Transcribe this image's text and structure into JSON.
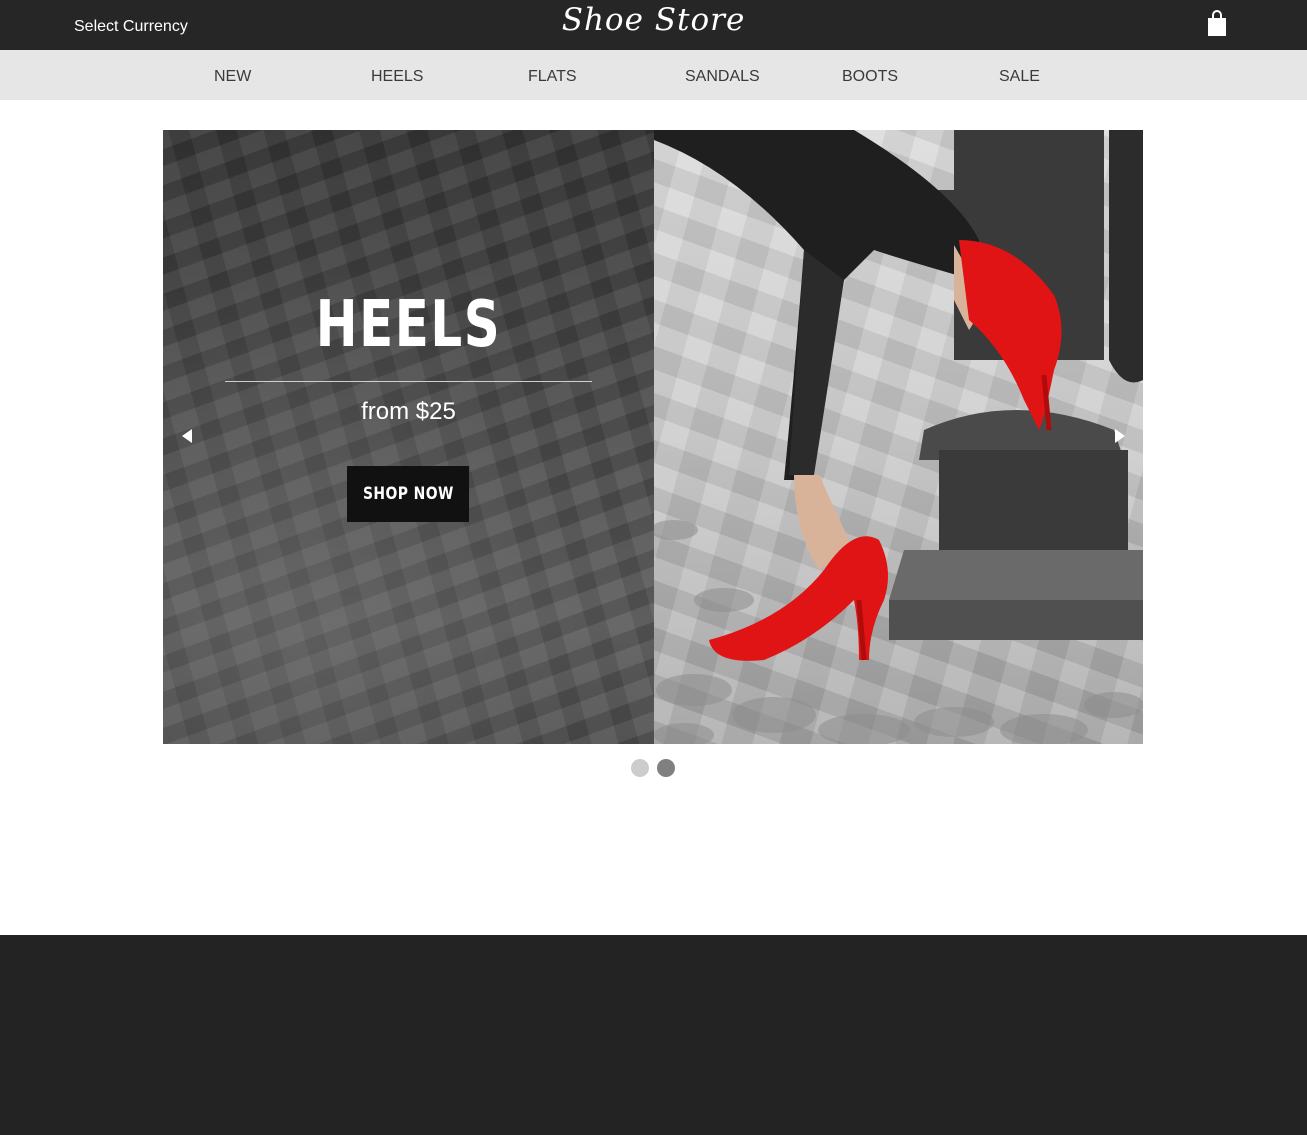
{
  "header": {
    "currency_label": "Select Currency",
    "brand": "Shoe Store",
    "cart_icon": "shopping-bag-icon"
  },
  "nav": {
    "items": [
      {
        "label": "NEW"
      },
      {
        "label": "HEELS"
      },
      {
        "label": "FLATS"
      },
      {
        "label": "SANDALS"
      },
      {
        "label": "BOOTS"
      },
      {
        "label": "SALE"
      }
    ]
  },
  "slider": {
    "title": "HEELS",
    "subtitle": "from $25",
    "cta_label": "SHOP NOW",
    "prev_icon": "triangle-left-icon",
    "next_icon": "triangle-right-icon",
    "slide_count": 2,
    "active_slide": 2
  },
  "colors": {
    "topbar": "#262626",
    "nav": "#e6e6e6",
    "footer": "#232323",
    "cta": "#111111",
    "shoe": "#e01414"
  }
}
